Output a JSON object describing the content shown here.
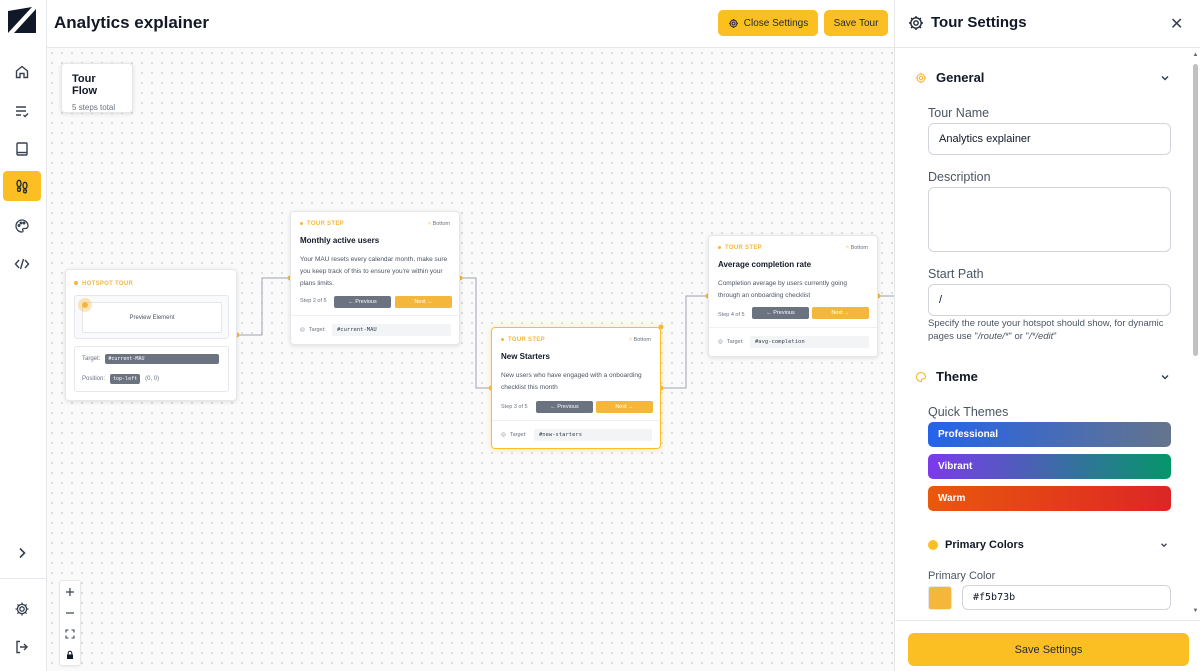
{
  "header": {
    "title": "Analytics explainer",
    "close_settings_label": "Close Settings",
    "save_tour_label": "Save Tour"
  },
  "sidebar": {
    "items": [
      {
        "name": "home",
        "icon": "home-icon",
        "active": false
      },
      {
        "name": "list",
        "icon": "list-check-icon",
        "active": false
      },
      {
        "name": "book",
        "icon": "book-icon",
        "active": false
      },
      {
        "name": "tours",
        "icon": "footprints-icon",
        "active": true
      },
      {
        "name": "palette",
        "icon": "palette-icon",
        "active": false
      },
      {
        "name": "code",
        "icon": "code-icon",
        "active": false
      }
    ],
    "expand_icon": "chevron-right-icon",
    "settings_icon": "gear-icon",
    "logout_icon": "logout-icon"
  },
  "canvas": {
    "flow": {
      "title": "Tour Flow",
      "subtitle": "5 steps total"
    },
    "hotspot": {
      "label": "HOTSPOT TOUR",
      "preview_label": "Preview Element",
      "target_label": "Target:",
      "target_value": "#current-MAU",
      "position_label": "Position:",
      "position_value": "top-left",
      "offset": "(0, 0)"
    },
    "steps": [
      {
        "label": "TOUR STEP",
        "position": "Bottom",
        "title": "Monthly active users",
        "body": "Your MAU resets every calendar month, make sure you keep track of this to ensure you're within your plans limits.",
        "counter": "Step 2 of 5",
        "prev_label": "← Previous",
        "next_label": "Next →",
        "target_label": "Target:",
        "target_value": "#current-MAU"
      },
      {
        "label": "TOUR STEP",
        "position": "Bottom",
        "title": "New Starters",
        "body": "New users who have engaged with a onboarding checklist this month",
        "counter": "Step 3 of 5",
        "prev_label": "← Previous",
        "next_label": "Next →",
        "target_label": "Target:",
        "target_value": "#new-starters"
      },
      {
        "label": "TOUR STEP",
        "position": "Bottom",
        "title": "Average completion rate",
        "body": "Completion average by users currently going through an onboarding checklist",
        "counter": "Step 4 of 5",
        "prev_label": "← Previous",
        "next_label": "Next →",
        "target_label": "Target:",
        "target_value": "#avg-completion"
      }
    ],
    "zoom_controls": [
      "+",
      "−",
      "fit",
      "lock"
    ]
  },
  "panel": {
    "title": "Tour Settings",
    "general": {
      "heading": "General",
      "tour_name_label": "Tour Name",
      "tour_name_value": "Analytics explainer",
      "description_label": "Description",
      "description_value": "",
      "start_path_label": "Start Path",
      "start_path_value": "/",
      "help_prefix": "Specify the route your hotspot should show, for dynamic pages use \"",
      "help_ex1": "/route/*",
      "help_mid": "\" or \"",
      "help_ex2": "/*/edit",
      "help_suffix": "\""
    },
    "theme": {
      "heading": "Theme",
      "quick_label": "Quick Themes",
      "themes": [
        {
          "name": "Professional",
          "from": "#2563eb",
          "to": "#64748b"
        },
        {
          "name": "Vibrant",
          "from": "#7c3aed",
          "to": "#059669"
        },
        {
          "name": "Warm",
          "from": "#ea580c",
          "to": "#dc2626"
        }
      ],
      "primary_colors_label": "Primary Colors",
      "primary_color_label": "Primary Color",
      "primary_color_value": "#f5b73b"
    },
    "save_label": "Save Settings"
  },
  "colors": {
    "accent": "#fbbf24",
    "accent_soft": "#f5b73b",
    "secondary": "#6b7280"
  }
}
